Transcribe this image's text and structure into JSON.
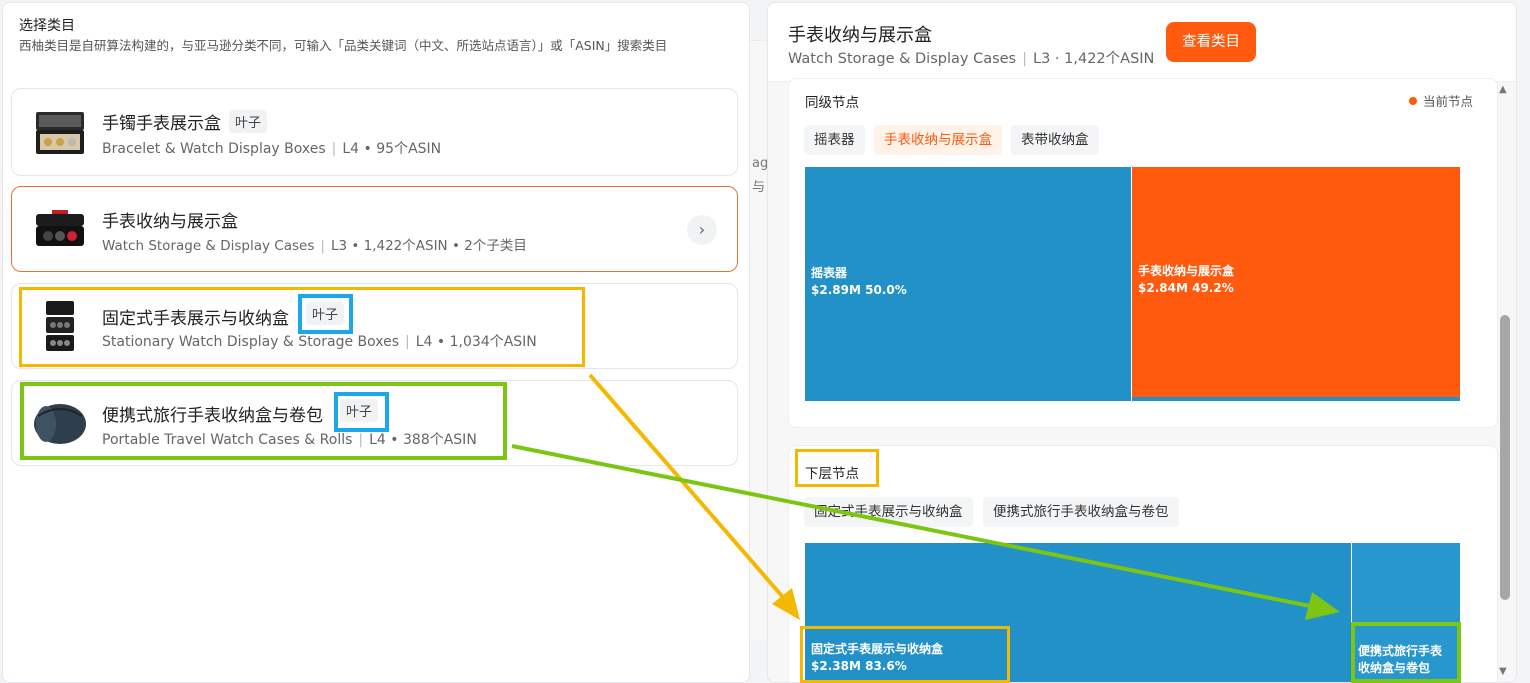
{
  "left": {
    "title": "选择类目",
    "description": "西柚类目是自研算法构建的，与亚马逊分类不同，可输入「品类关键词（中文、所选站点语言）」或「ASIN」搜索类目",
    "categories": [
      {
        "zh": "手镯手表展示盒",
        "en": "Bracelet & Watch Display Boxes",
        "level": "L4",
        "asin": "95个ASIN",
        "tag": "叶子",
        "children": ""
      },
      {
        "zh": "手表收纳与展示盒",
        "en": "Watch Storage & Display Cases",
        "level": "L3",
        "asin": "1,422个ASIN",
        "tag": "",
        "children": "2个子类目"
      },
      {
        "zh": "固定式手表展示与收纳盒",
        "en": "Stationary Watch Display & Storage Boxes",
        "level": "L4",
        "asin": "1,034个ASIN",
        "tag": "叶子",
        "children": ""
      },
      {
        "zh": "便携式旅行手表收纳盒与卷包",
        "en": "Portable Travel Watch Cases & Rolls",
        "level": "L4",
        "asin": "388个ASIN",
        "tag": "叶子",
        "children": ""
      }
    ],
    "bullet": "•",
    "chevron": "›"
  },
  "middle": {
    "text1": "ag",
    "text2": "与"
  },
  "right": {
    "title": "手表收纳与展示盒",
    "subtitle_en": "Watch Storage & Display Cases",
    "level": "L3",
    "dot": "·",
    "asin": "1,422个ASIN",
    "view_button": "查看类目",
    "sibling": {
      "title": "同级节点",
      "legend": "当前节点",
      "chips": [
        "摇表器",
        "手表收纳与展示盒",
        "表带收纳盒"
      ],
      "treemap": [
        {
          "name": "摇表器",
          "value": "$2.89M",
          "share": "50.0%",
          "color": "#2191c8"
        },
        {
          "name": "手表收纳与展示盒",
          "value": "$2.84M",
          "share": "49.2%",
          "color": "#ff5a0e"
        }
      ]
    },
    "children": {
      "title": "下层节点",
      "chips": [
        "固定式手表展示与收纳盒",
        "便携式旅行手表收纳盒与卷包"
      ],
      "treemap": [
        {
          "name": "固定式手表展示与收纳盒",
          "value": "$2.38M",
          "share": "83.6%",
          "color": "#2191c8"
        },
        {
          "name": "便携式旅行手表收纳盒与卷包",
          "value": "",
          "share": "",
          "color": "#2191c8",
          "line1": "便携式旅行手表",
          "line2": "收纳盒与卷包"
        }
      ]
    }
  },
  "colors": {
    "accent": "#ff5a0e",
    "blue": "#2191c8",
    "highlight_yellow": "#f5b800",
    "highlight_green": "#7cc512",
    "highlight_blue": "#1ba7ea"
  }
}
